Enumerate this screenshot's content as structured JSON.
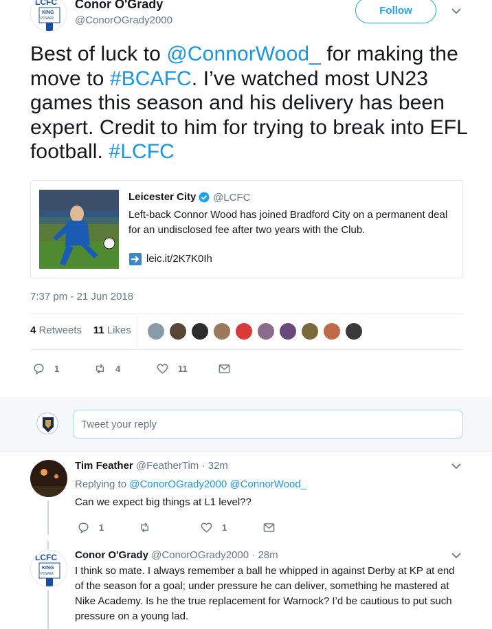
{
  "tweet": {
    "author_name": "Conor O'Grady",
    "author_handle": "@ConorOGrady2000",
    "follow_label": "Follow",
    "text_parts": [
      {
        "text": "Best of luck to ",
        "link": false
      },
      {
        "text": "@ConnorWood_",
        "link": true
      },
      {
        "text": " for making the move to ",
        "link": false
      },
      {
        "text": "#BCAFC",
        "link": true
      },
      {
        "text": ". I’ve watched most UN23 games this season and his delivery has been expert. Credit to him for trying to break into EFL football. ",
        "link": false
      },
      {
        "text": "#LCFC",
        "link": true
      }
    ],
    "timestamp": "7:37 pm - 21 Jun 2018",
    "retweets_count": "4",
    "retweets_label": "Retweets",
    "likes_count": "11",
    "likes_label": "Likes",
    "actions": {
      "reply_count": "1",
      "retweet_count": "4",
      "like_count": "11"
    }
  },
  "quoted": {
    "name": "Leicester City",
    "handle": "@LCFC",
    "text": "Left-back Connor Wood has joined Bradford City on a permanent deal for an undisclosed fee after two years with the Club.",
    "link": "leic.it/2K7K0Ih"
  },
  "reply_box": {
    "placeholder": "Tweet your reply"
  },
  "replies": [
    {
      "name": "Tim Feather",
      "handle": "@FeatherTim",
      "time": "· 32m",
      "replying_label": "Replying to",
      "replying_to": "@ConorOGrady2000 @ConnorWood_",
      "text": "Can we expect big things at L1 level??",
      "reply_count": "1",
      "retweet_count": "",
      "like_count": "1"
    },
    {
      "name": "Conor O'Grady",
      "handle": "@ConorOGrady2000",
      "time": "· 28m",
      "text": "I think so mate. I always remember a ball he whipped in against Derby at KP at end of the season for a goal; under pressure he can deliver, something he mastered at Nike Academy. Is he the true replacement for Warnock? I’d be cautious to put such pressure on a young lad."
    }
  ],
  "colors": {
    "link": "#1b95e0",
    "follow": "#1da1f2",
    "muted": "#657786"
  }
}
